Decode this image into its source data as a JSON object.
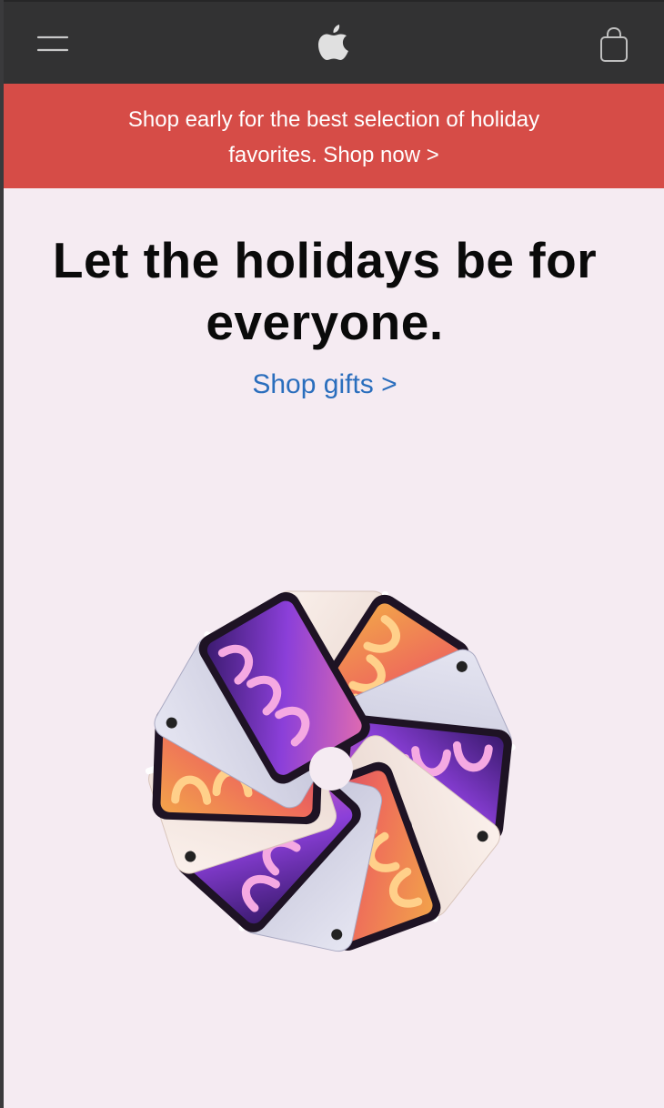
{
  "nav": {
    "menu_icon": "hamburger-menu-icon",
    "logo_icon": "apple-logo-icon",
    "bag_icon": "shopping-bag-icon"
  },
  "promo_banner": {
    "text": "Shop early for the best selection of holiday favorites. Shop now >"
  },
  "hero": {
    "headline": "Let the holidays be for everyone.",
    "cta_label": "Shop gifts >",
    "image": "ipad-mini-pinwheel-image"
  },
  "colors": {
    "navbar_bg": "#323233",
    "promo_bg": "#d64c47",
    "page_bg": "#f5ebf2",
    "link": "#2a6ebd",
    "headline": "#0a0a0a"
  }
}
